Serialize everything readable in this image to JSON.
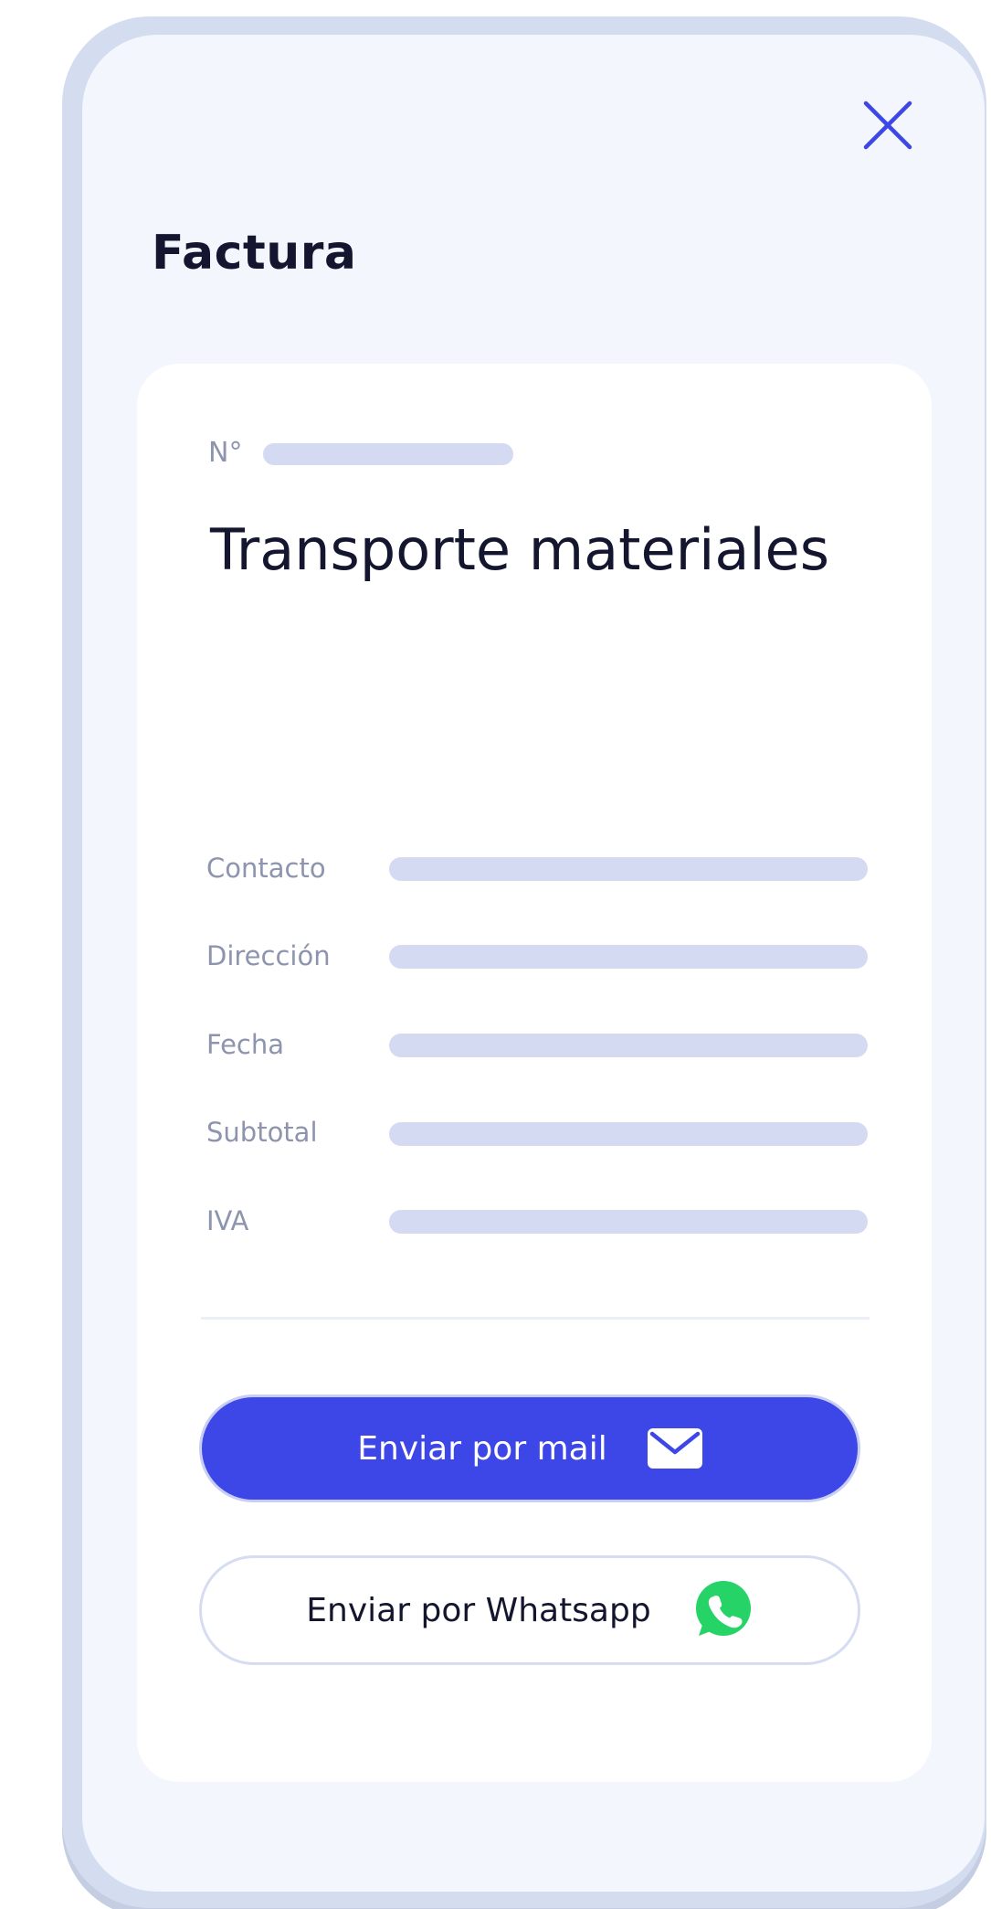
{
  "header": {
    "title": "Factura",
    "close_icon": "close-icon"
  },
  "invoice": {
    "number_label": "N°",
    "title": "Transporte materiales",
    "fields": [
      {
        "label": "Contacto"
      },
      {
        "label": "Dirección"
      },
      {
        "label": "Fecha"
      },
      {
        "label": "Subtotal"
      },
      {
        "label": "IVA"
      }
    ]
  },
  "actions": {
    "mail_label": "Enviar por mail",
    "mail_icon": "envelope-icon",
    "whatsapp_label": "Enviar por Whatsapp",
    "whatsapp_icon": "whatsapp-icon"
  },
  "colors": {
    "accent": "#3d47e7",
    "whatsapp": "#25d366",
    "placeholder_bar": "#d4daf1",
    "frame": "#d4dcf0",
    "background": "#f3f6fc",
    "text_primary": "#13162e",
    "text_muted": "#8d94ad"
  }
}
